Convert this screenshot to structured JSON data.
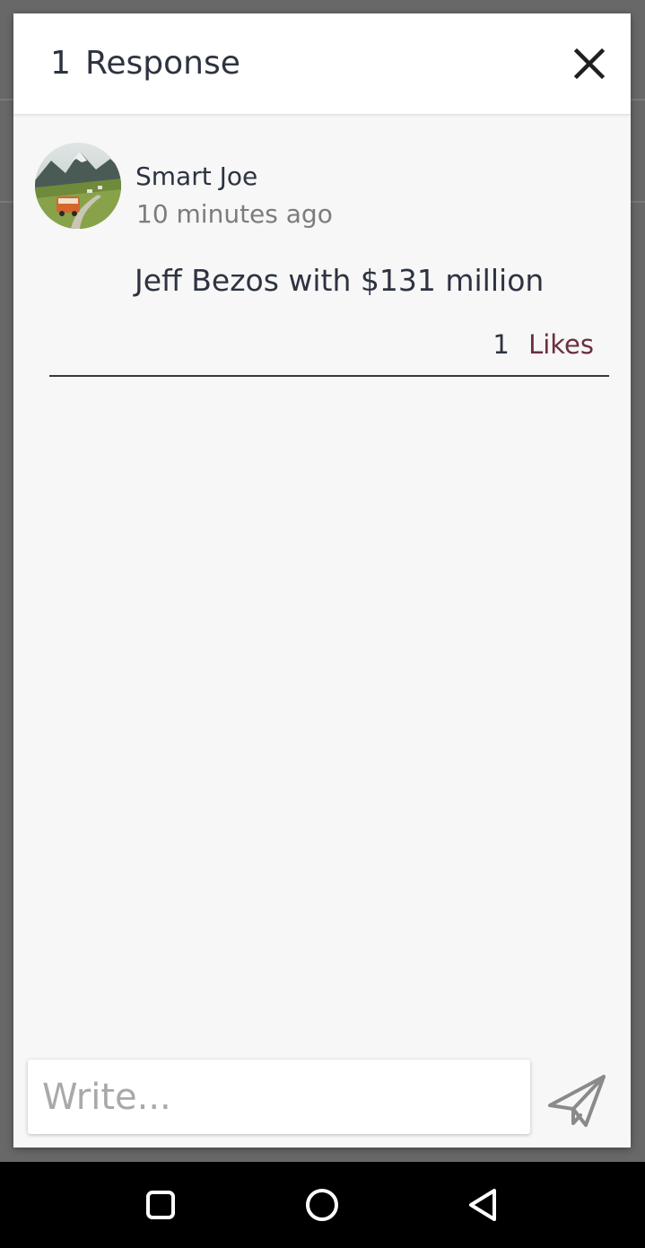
{
  "dialog": {
    "response_count": "1",
    "title": "Response",
    "close_icon": "close-icon"
  },
  "comment": {
    "author": "Smart Joe",
    "timestamp": "10 minutes ago",
    "text": "Jeff Bezos with $131 million",
    "likes_count": "1",
    "likes_label": "Likes",
    "avatar_icon": "avatar-landscape-van"
  },
  "composer": {
    "placeholder": "Write...",
    "value": "",
    "send_icon": "send-paper-plane-icon"
  },
  "nav": {
    "recents_icon": "square-recents-icon",
    "home_icon": "circle-home-icon",
    "back_icon": "triangle-back-icon"
  },
  "colors": {
    "dialog_background": "#f7f7f7",
    "header_background": "#ffffff",
    "text_primary": "#2d3340",
    "text_secondary": "#7c7c7c",
    "likes_accent": "#6b2f3d",
    "scrim": "#686868",
    "nav_bar": "#000000"
  }
}
